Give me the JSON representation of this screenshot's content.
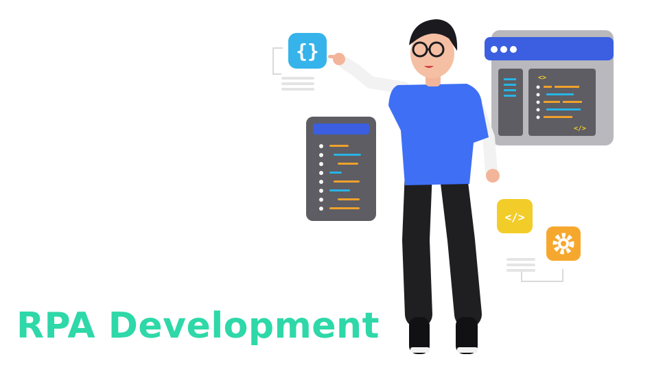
{
  "heading": {
    "text": "RPA Development"
  },
  "illustration": {
    "subject": "developer-pointing-figure",
    "icons": [
      "curly-braces-icon",
      "code-tag-icon",
      "gear-icon",
      "browser-window-icon",
      "code-list-panel-icon"
    ],
    "colors": {
      "heading": "#2ed8a8",
      "shirt": "#3e6ff5",
      "pants": "#1f1f22",
      "panel_frame": "#5d5d63",
      "panel_blue": "#3b5fe0",
      "code_orange": "#f0a12b",
      "code_cyan": "#28b4e6",
      "braces_tile": "#36b3ea",
      "code_tile": "#f2cd2a",
      "gear_tile": "#f6a82e"
    }
  }
}
